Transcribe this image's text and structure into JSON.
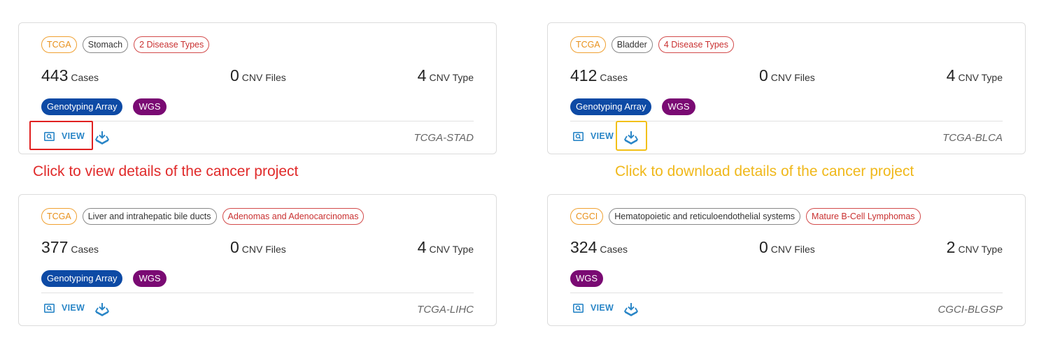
{
  "colors": {
    "program_tag": "#e8901a",
    "disease_tag": "#c93030",
    "genotyping_pill": "#0d4aa5",
    "wgs_pill": "#7a0a73",
    "action_blue": "#2a86c7",
    "annotation_red": "#e02a2a",
    "annotation_yellow": "#f0b81a"
  },
  "cards": [
    {
      "program": "TCGA",
      "primary_site": "Stomach",
      "disease_types": "2 Disease Types",
      "cases": {
        "value": "443",
        "unit": "Cases"
      },
      "cnv_files": {
        "value": "0",
        "unit": "CNV Files"
      },
      "cnv_types": {
        "value": "4",
        "unit": "CNV Type"
      },
      "strategies": [
        "Genotyping Array",
        "WGS"
      ],
      "view_label": "VIEW",
      "view_icon": "search-doc-icon",
      "download_icon": "download-tray-icon",
      "project_id": "TCGA-STAD"
    },
    {
      "program": "TCGA",
      "primary_site": "Bladder",
      "disease_types": "4 Disease Types",
      "cases": {
        "value": "412",
        "unit": "Cases"
      },
      "cnv_files": {
        "value": "0",
        "unit": "CNV Files"
      },
      "cnv_types": {
        "value": "4",
        "unit": "CNV Type"
      },
      "strategies": [
        "Genotyping Array",
        "WGS"
      ],
      "view_label": "VIEW",
      "view_icon": "search-doc-icon",
      "download_icon": "download-tray-icon",
      "project_id": "TCGA-BLCA"
    },
    {
      "program": "TCGA",
      "primary_site": "Liver and intrahepatic bile ducts",
      "disease_types": "Adenomas and Adenocarcinomas",
      "cases": {
        "value": "377",
        "unit": "Cases"
      },
      "cnv_files": {
        "value": "0",
        "unit": "CNV Files"
      },
      "cnv_types": {
        "value": "4",
        "unit": "CNV Type"
      },
      "strategies": [
        "Genotyping Array",
        "WGS"
      ],
      "view_label": "VIEW",
      "view_icon": "search-doc-icon",
      "download_icon": "download-tray-icon",
      "project_id": "TCGA-LIHC"
    },
    {
      "program": "CGCI",
      "primary_site": "Hematopoietic and reticuloendothelial systems",
      "disease_types": "Mature B-Cell Lymphomas",
      "cases": {
        "value": "324",
        "unit": "Cases"
      },
      "cnv_files": {
        "value": "0",
        "unit": "CNV Files"
      },
      "cnv_types": {
        "value": "2",
        "unit": "CNV Type"
      },
      "strategies": [
        "WGS"
      ],
      "view_label": "VIEW",
      "view_icon": "search-doc-icon",
      "download_icon": "download-tray-icon",
      "project_id": "CGCI-BLGSP"
    }
  ],
  "annotations": {
    "view": "Click to view details of the cancer project",
    "download": "Click to download details of the cancer project"
  }
}
